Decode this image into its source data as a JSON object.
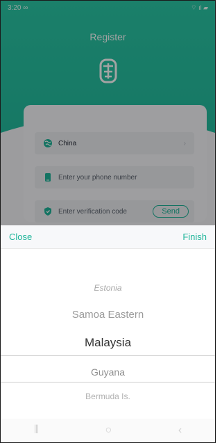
{
  "status_bar": {
    "time": "3:20 ∞",
    "right": "⌔ ıl ▰"
  },
  "register": {
    "title": "Register",
    "country": "China",
    "phone_placeholder": "Enter your phone number",
    "code_placeholder": "Enter verification code",
    "send_label": "Send"
  },
  "picker": {
    "close_label": "Close",
    "finish_label": "Finish",
    "options_far_top": "",
    "options": [
      "Estonia",
      "Samoa Eastern",
      "Malaysia",
      "Guyana",
      "Bermuda Is.",
      ""
    ]
  },
  "colors": {
    "accent": "#1fb59a",
    "hero": "#2bc8a6"
  }
}
